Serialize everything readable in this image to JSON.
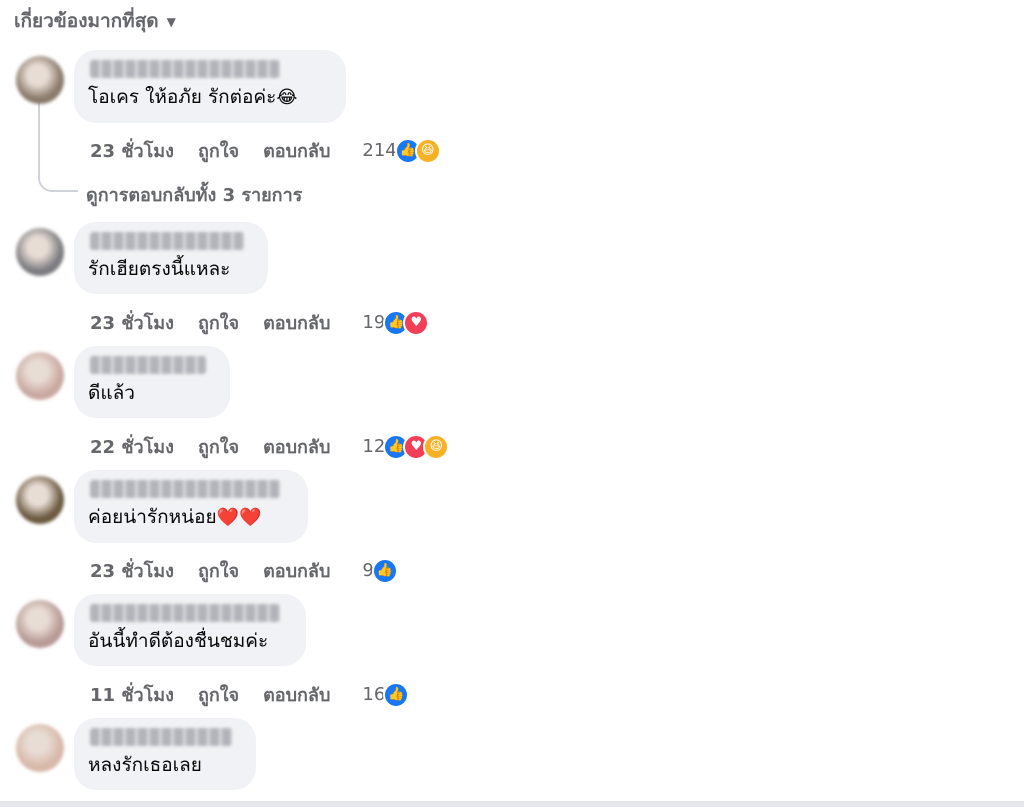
{
  "sort": {
    "label": "เกี่ยวข้องมากที่สุด",
    "caret_icon": "chevron-down-icon"
  },
  "actions": {
    "like": "ถูกใจ",
    "reply": "ตอบกลับ"
  },
  "view_replies": "ดูการตอบกลับทั้ง 3 รายการ",
  "colors": {
    "bubble": "#f0f2f5",
    "meta": "#65676b",
    "like": "#1877f2",
    "love": "#f33e58",
    "haha": "#f7b125"
  },
  "comments": [
    {
      "name": "ประกายแก้ว แสงสุริย",
      "text": "โอเคร ให้อภัย รักต่อค่ะ",
      "emoji": "😂",
      "time": "23 ชั่วโมง",
      "count": "214",
      "reactions": [
        "like",
        "haha"
      ],
      "avatar_color": "#8a7a6a"
    },
    {
      "name": "Su Kee",
      "text": "รักเฮียตรงนี้แหละ",
      "emoji": "",
      "time": "23 ชั่วโมง",
      "count": "19",
      "reactions": [
        "like",
        "love"
      ],
      "avatar_color": "#7c7c80"
    },
    {
      "name": "Kanyarat Kaew",
      "text": "ดีแล้ว",
      "emoji": "",
      "time": "22 ชั่วโมง",
      "count": "12",
      "reactions": [
        "like",
        "love",
        "haha"
      ],
      "avatar_color": "#c9a8a0"
    },
    {
      "name": "Wichitra Paensuwong",
      "text": "ค่อยน่ารักหน่อย",
      "emoji": "❤️❤️",
      "time": "23 ชั่วโมง",
      "count": "9",
      "reactions": [
        "like"
      ],
      "avatar_color": "#6b5a40"
    },
    {
      "name": "Supharat Bhirom",
      "text": "อันนี้ทำดีต้องชื่นชมค่ะ",
      "emoji": "",
      "time": "11 ชั่วโมง",
      "count": "16",
      "reactions": [
        "like"
      ],
      "avatar_color": "#b89a96"
    },
    {
      "name": "ทราย อรวรรณดี",
      "text": "หลงรักเธอเลย",
      "emoji": "",
      "time": "",
      "count": "",
      "reactions": [],
      "avatar_color": "#d8b8a8"
    }
  ]
}
